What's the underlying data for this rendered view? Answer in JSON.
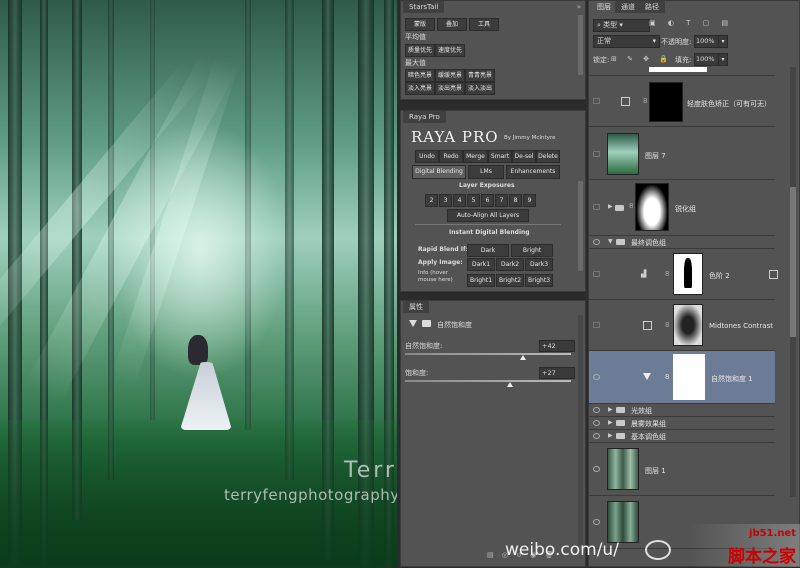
{
  "watermark": {
    "name": "Terry  F",
    "url": "terryfengphotography.lofter.com",
    "weibo": "weibo.com/u/",
    "site_domain": "jb51.net",
    "site_name": "脚本之家"
  },
  "starstail": {
    "tab": "StarsTail",
    "top_buttons": [
      "蒙版",
      "叠加",
      "工具"
    ],
    "section1": "平均值",
    "row1": [
      "质量优先",
      "速度优先"
    ],
    "section2": "最大值",
    "row2": [
      "暗色亮景",
      "缓缓亮景",
      "青青亮景"
    ],
    "row3": [
      "淡入亮景",
      "淡出亮景",
      "淡入淡出"
    ]
  },
  "raya": {
    "tab": "Raya Pro",
    "title": "RAYA PRO",
    "byline": "By Jimmy McIntyre",
    "toolbar": [
      "Undo",
      "Redo",
      "Merge",
      "Smart",
      "De-sel",
      "Delete"
    ],
    "tabs": [
      "Digital Blending",
      "LMs",
      "Enhancements"
    ],
    "layer_exposures": "Layer Exposures",
    "exposure_numbers": [
      "2",
      "3",
      "4",
      "5",
      "6",
      "7",
      "8",
      "9"
    ],
    "auto_align": "Auto-Align All Layers",
    "instant_heading": "Instant Digital Blending",
    "rapid_blend": "Rapid Blend If:",
    "dark": "Dark",
    "bright": "Bright",
    "apply_image": "Apply Image:",
    "darks": [
      "Dark1",
      "Dark2",
      "Dark3"
    ],
    "info": "Info (hover mouse here)",
    "brights": [
      "Bright1",
      "Bright2",
      "Bright3"
    ]
  },
  "properties": {
    "tab": "属性",
    "header": "自然饱和度",
    "vibrance_label": "自然饱和度:",
    "vibrance_value": "+42",
    "vibrance_fraction": 0.71,
    "saturation_label": "饱和度:",
    "saturation_value": "+27",
    "saturation_fraction": 0.635
  },
  "layers_panel": {
    "tabs": [
      "图层",
      "通道",
      "路径"
    ],
    "filter_kind": "类型",
    "blend_mode": "正常",
    "opacity_label": "不透明度:",
    "opacity_value": "100%",
    "lock_label": "锁定:",
    "fill_label": "填充:",
    "fill_value": "100%",
    "layers": [
      {
        "name": "轻度肤色矫正（可有可无）"
      },
      {
        "name": "图层 7"
      },
      {
        "name": "锐化组"
      },
      {
        "name": "最终调色组"
      },
      {
        "name": "色阶 2"
      },
      {
        "name": "Midtones Contrast"
      },
      {
        "name": "自然饱和度 1"
      },
      {
        "name": "光效组"
      },
      {
        "name": "晨雾效果组"
      },
      {
        "name": "基本调色组"
      },
      {
        "name": "图层 1"
      }
    ]
  }
}
